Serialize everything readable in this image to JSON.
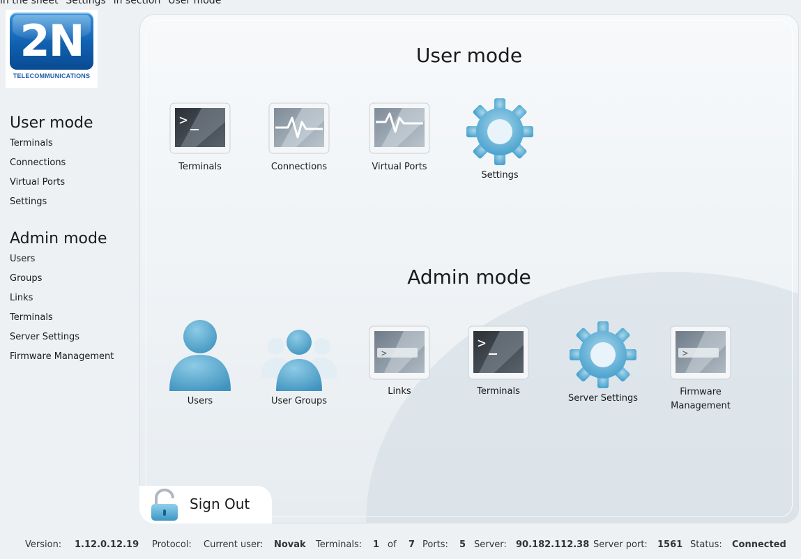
{
  "caption": "in the sheet \"Settings\" in section \"User mode\"",
  "logo": {
    "mark": "2N",
    "subtitle": "TELECOMMUNICATIONS"
  },
  "sidebar": {
    "user_mode": {
      "title": "User mode",
      "items": [
        {
          "label": "Terminals"
        },
        {
          "label": "Connections"
        },
        {
          "label": "Virtual Ports"
        },
        {
          "label": "Settings"
        }
      ]
    },
    "admin_mode": {
      "title": "Admin mode",
      "items": [
        {
          "label": "Users"
        },
        {
          "label": "Groups"
        },
        {
          "label": "Links"
        },
        {
          "label": "Terminals"
        },
        {
          "label": "Server Settings"
        },
        {
          "label": "Firmware Management"
        }
      ]
    }
  },
  "main": {
    "user_mode_title": "User mode",
    "admin_mode_title": "Admin mode",
    "user_tiles": [
      {
        "label": "Terminals",
        "icon": "terminal-icon"
      },
      {
        "label": "Connections",
        "icon": "connection-pulse-icon"
      },
      {
        "label": "Virtual Ports",
        "icon": "virtual-port-pulse-icon"
      },
      {
        "label": "Settings",
        "icon": "gear-icon"
      }
    ],
    "admin_tiles": [
      {
        "label": "Users",
        "icon": "user-icon"
      },
      {
        "label": "User Groups",
        "icon": "user-group-icon"
      },
      {
        "label": "Links",
        "icon": "link-console-icon"
      },
      {
        "label": "Terminals",
        "icon": "terminal-icon"
      },
      {
        "label": "Server Settings",
        "icon": "gear-icon"
      },
      {
        "label": "Firmware",
        "label2": "Management",
        "icon": "firmware-console-icon"
      }
    ]
  },
  "signout": {
    "label": "Sign Out",
    "icon": "unlocked-padlock-icon"
  },
  "status": {
    "version_label": "Version:",
    "version": "1.12.0.12.19",
    "protocol_label": "Protocol:",
    "user_label": "Current user:",
    "user": "Novak",
    "terminals_label": "Terminals:",
    "terminals_count": "1",
    "of_label": "of",
    "terminals_total": "7",
    "ports_label": "Ports:",
    "ports": "5",
    "server_label": "Server:",
    "server": "90.182.112.38",
    "server_port_label": "Server port:",
    "server_port": "1561",
    "status_label": "Status:",
    "status": "Connected"
  },
  "colors": {
    "accent_blue": "#5aaed6",
    "icon_blue": "#4fa6cf",
    "logo_blue": "#1a66b6"
  }
}
